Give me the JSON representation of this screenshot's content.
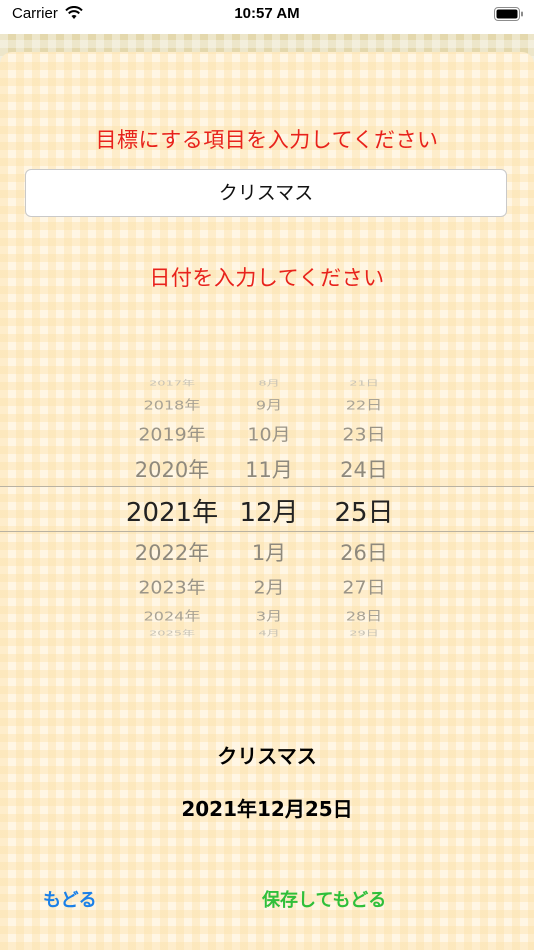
{
  "status_bar": {
    "carrier": "Carrier",
    "time": "10:57 AM"
  },
  "form": {
    "item_prompt": "目標にする項目を入力してください",
    "item_value": "クリスマス",
    "date_prompt": "日付を入力してください"
  },
  "date_picker": {
    "years": [
      "2017年",
      "2018年",
      "2019年",
      "2020年",
      "2021年",
      "2022年",
      "2023年",
      "2024年",
      "2025年"
    ],
    "months": [
      "8月",
      "9月",
      "10月",
      "11月",
      "12月",
      "1月",
      "2月",
      "3月",
      "4月"
    ],
    "days": [
      "21日",
      "22日",
      "23日",
      "24日",
      "25日",
      "26日",
      "27日",
      "28日",
      "29日"
    ],
    "selected": {
      "year": "2021年",
      "month": "12月",
      "day": "25日"
    }
  },
  "summary": {
    "title": "クリスマス",
    "date": "2021年12月25日"
  },
  "footer": {
    "back_label": "もどる",
    "save_back_label": "保存してもどる"
  },
  "colors": {
    "prompt": "#e8221b",
    "back_button": "#1b80e8",
    "save_back_button": "#2fbf3a",
    "sheet_background": "#fff6e4"
  },
  "icons": [
    "wifi-icon",
    "battery-icon"
  ]
}
